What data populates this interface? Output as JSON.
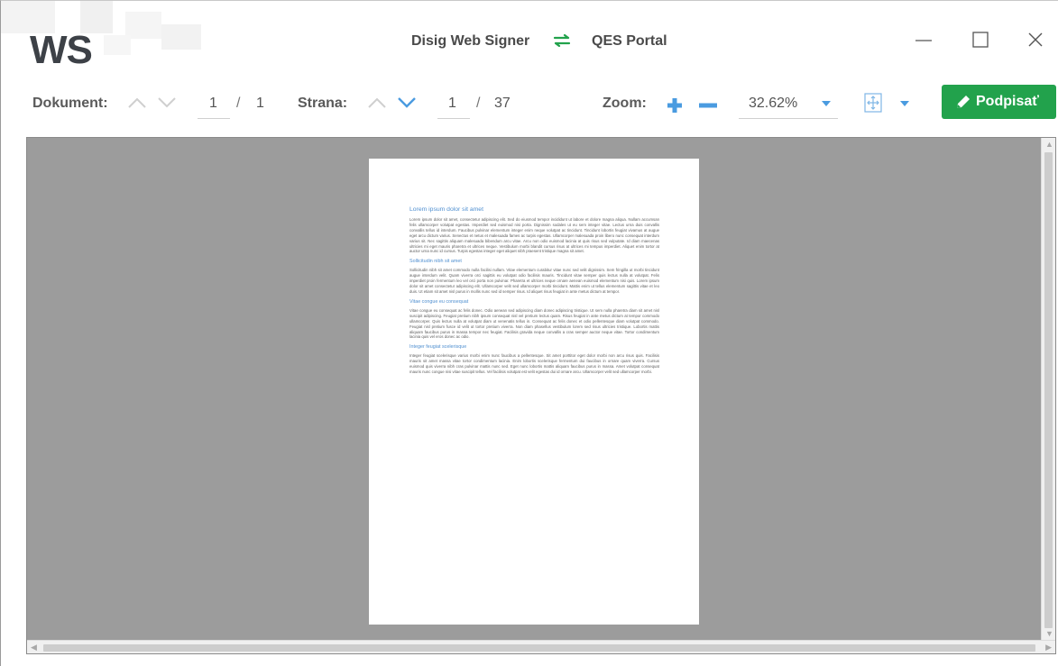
{
  "app": {
    "logo_text": "WS",
    "title_left": "Disig Web Signer",
    "title_right": "QES Portal",
    "accent_color": "#22a24c",
    "link_color": "#4a9be0"
  },
  "window_controls": {
    "minimize_icon": "minimize-icon",
    "maximize_icon": "maximize-icon",
    "close_icon": "close-icon"
  },
  "toolbar": {
    "document_label": "Dokument:",
    "document_current": "1",
    "document_separator": "/",
    "document_total": "1",
    "page_label": "Strana:",
    "page_current": "1",
    "page_separator": "/",
    "page_total": "37",
    "zoom_label": "Zoom:",
    "zoom_value": "32.62%",
    "sign_label": "Podpisať"
  },
  "document": {
    "heading_1": "Lorem ipsum dolor sit amet",
    "para_1": "Lorem ipsum dolor sit amet, consectetur adipiscing elit. Sed do eiusmod tempor incididunt ut labore et dolore magna aliqua. Nullam accumsan felis ullamcorper volutpat egestas. Imperdiet sed euismod nisi porta. Dignissim sodales ut eu sem integer vitae. Lectus urna duis convallis convallis tellus id interdum. Faucibus pulvinar elementum integer enim neque volutpat ac tincidunt. Tincidunt lobortis feugiat vivamus at augue eget arcu dictum varius. Senectus et netus et malesuada fames ac turpis egestas. Ullamcorper malesuada proin libero nunc consequat interdum varius sit. Nec sagittis aliquam malesuada bibendum arcu vitae. Arcu non odio euismod lacinia at quis risus sed vulputate. Id diam maecenas ultricies mi eget mauris pharetra et ultrices neque. Vestibulum morbi blandit cursus risus at ultrices mi tempus imperdiet. Aliquet enim tortor at auctor urna nunc id cursus. Turpis egestas integer eget aliquet nibh praesent tristique magna sit amet.",
    "heading_2": "Sollicitudin nibh sit amet",
    "para_2": "Sollicitudin nibh sit amet commodo nulla facilisi nullam. Vitae elementum curabitur vitae nunc sed velit dignissim. Sem fringilla ut morbi tincidunt augue interdum velit. Quam viverra orci sagittis eu volutpat odio facilisis mauris. Tincidunt vitae semper quis lectus nulla at volutpat. Felis imperdiet proin fermentum leo vel orci porta non pulvinar. Pharetra et ultrices neque ornare aenean euismod elementum nisi quis. Lorem ipsum dolor sit amet consectetur adipiscing elit. Ullamcorper velit sed ullamcorper morbi tincidunt. Mattis enim ut tellus elementum sagittis vitae et leo duis. Ut etiam sit amet nisl purus in mollis nunc sed id semper risus. Id aliquet risus feugiat in ante metus dictum at tempor.",
    "heading_3": "Vitae congue eu consequat",
    "para_3": "Vitae congue eu consequat ac felis donec. Odio aenean sed adipiscing diam donec adipiscing tristique. Ut sem nulla pharetra diam sit amet nisl suscipit adipiscing. Feugiat pretium nibh ipsum consequat nisl vel pretium lectus quam. Risus feugiat in ante metus dictum at tempor commodo ullamcorper. Quis lectus nulla at volutpat diam ut venenatis tellus in. Consequat ac felis donec et odio pellentesque diam volutpat commodo. Feugiat nisl pretium fusce id velit ut tortor pretium viverra. Non diam phasellus vestibulum lorem sed risus ultricies tristique. Lobortis mattis aliquam faucibus purus in massa tempor nec feugiat. Facilisis gravida neque convallis a cras semper auctor neque vitae. Tortor condimentum lacinia quis vel eros donec ac odio.",
    "heading_4": "Integer feugiat scelerisque",
    "para_4": "Integer feugiat scelerisque varius morbi enim nunc faucibus a pellentesque. Sit amet porttitor eget dolor morbi non arcu risus quis. Facilisis mauris sit amet massa vitae tortor condimentum lacinia. Enim lobortis scelerisque fermentum dui faucibus in ornare quam viverra. Cursus euismod quis viverra nibh cras pulvinar mattis nunc sed. Eget nunc lobortis mattis aliquam faucibus purus in massa. Amet volutpat consequat mauris nunc congue nisi vitae suscipit tellus. Vel facilisis volutpat est velit egestas dui id ornare arcu. Ullamcorper velit sed ullamcorper morbi."
  }
}
